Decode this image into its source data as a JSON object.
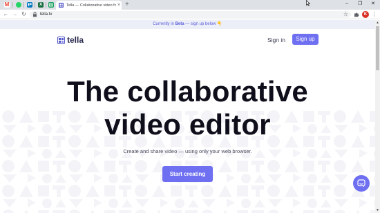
{
  "browser": {
    "pinned_tabs": [
      {
        "icon": "gmail-icon",
        "glyph": "M",
        "color": "#ea4335"
      },
      {
        "icon": "whatsapp-icon",
        "glyph": "",
        "color": "#25d366"
      },
      {
        "icon": "trello-icon",
        "glyph": "",
        "color": "#0079bf"
      },
      {
        "icon": "excel-icon",
        "glyph": "X",
        "color": "#1d6f42"
      },
      {
        "icon": "sheets-icon",
        "glyph": "",
        "color": "#0f9d58"
      }
    ],
    "active_tab_title": "Tella — Collaborative video for y",
    "tab_close": "×",
    "new_tab": "+",
    "window_controls": {
      "minimize": "–",
      "restore": "❐",
      "close": "✕"
    },
    "nav": {
      "back": "←",
      "forward": "→",
      "reload": "↻"
    },
    "url": "tella.tv",
    "star": "☆",
    "profile_initial": "K",
    "menu": "⋮"
  },
  "banner": {
    "pre": "Currently in ",
    "highlight": "Beta",
    "post": " — sign up below",
    "emoji": "👇"
  },
  "header": {
    "logo_text": "tella",
    "signin": "Sign in",
    "signup": "Sign up"
  },
  "hero": {
    "line1": "The collaborative",
    "line2": "video editor",
    "subtitle": "Create and share video — using only your web browser.",
    "cta": "Start creating"
  },
  "colors": {
    "accent": "#6e6ff1",
    "banner_bg": "#eceef8",
    "banner_text": "#5a5cdb",
    "heading": "#0e0f1a"
  },
  "icons": {
    "chat": "chat-bubble-icon",
    "lock": "lock-icon",
    "extensions": "puzzle-icon"
  }
}
